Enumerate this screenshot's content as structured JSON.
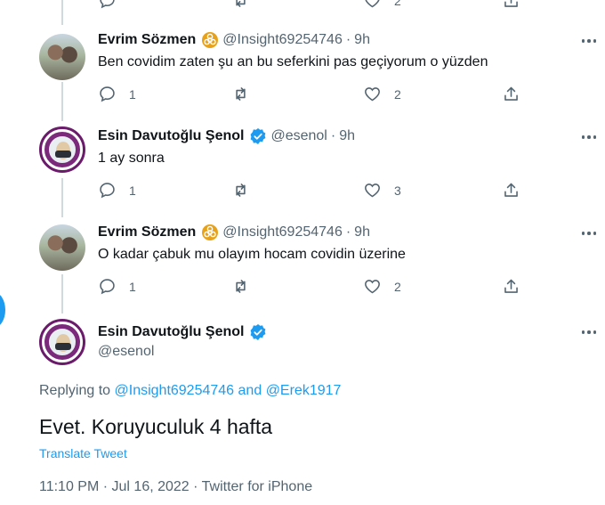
{
  "top_actions": {
    "replies": "",
    "retweets": "",
    "likes": "2"
  },
  "tweets": [
    {
      "name": "Evrim Sözmen",
      "badge": "biohazard-icon",
      "handle": "@Insight69254746",
      "time": "9h",
      "text": "Ben covidim zaten şu an bu seferkini pas geçiyorum o yüzden",
      "replies": "1",
      "likes": "2"
    },
    {
      "name": "Esin Davutoğlu Şenol",
      "badge": "verified-icon",
      "handle": "@esenol",
      "time": "9h",
      "text": "1 ay sonra",
      "replies": "1",
      "likes": "3"
    },
    {
      "name": "Evrim Sözmen",
      "badge": "biohazard-icon",
      "handle": "@Insight69254746",
      "time": "9h",
      "text": "O kadar çabuk mu olayım hocam covidin üzerine",
      "replies": "1",
      "likes": "2"
    }
  ],
  "separator": "·",
  "main_tweet": {
    "name": "Esin Davutoğlu Şenol",
    "handle": "@esenol",
    "replying_prefix": "Replying to",
    "replying_user1": "@Insight69254746",
    "replying_and": "and",
    "replying_user2": "@Erek1917",
    "text": "Evet. Koruyuculuk 4 hafta",
    "translate_label": "Translate Tweet",
    "timestamp": "11:10 PM · Jul 16, 2022 · Twitter for iPhone"
  },
  "colors": {
    "text": "#0f1419",
    "muted": "#536471",
    "link": "#1d9bf0",
    "verified": "#1d9bf0",
    "biohazard_badge": "#e8a21a",
    "avatar_ring": "#7b2a7b"
  }
}
